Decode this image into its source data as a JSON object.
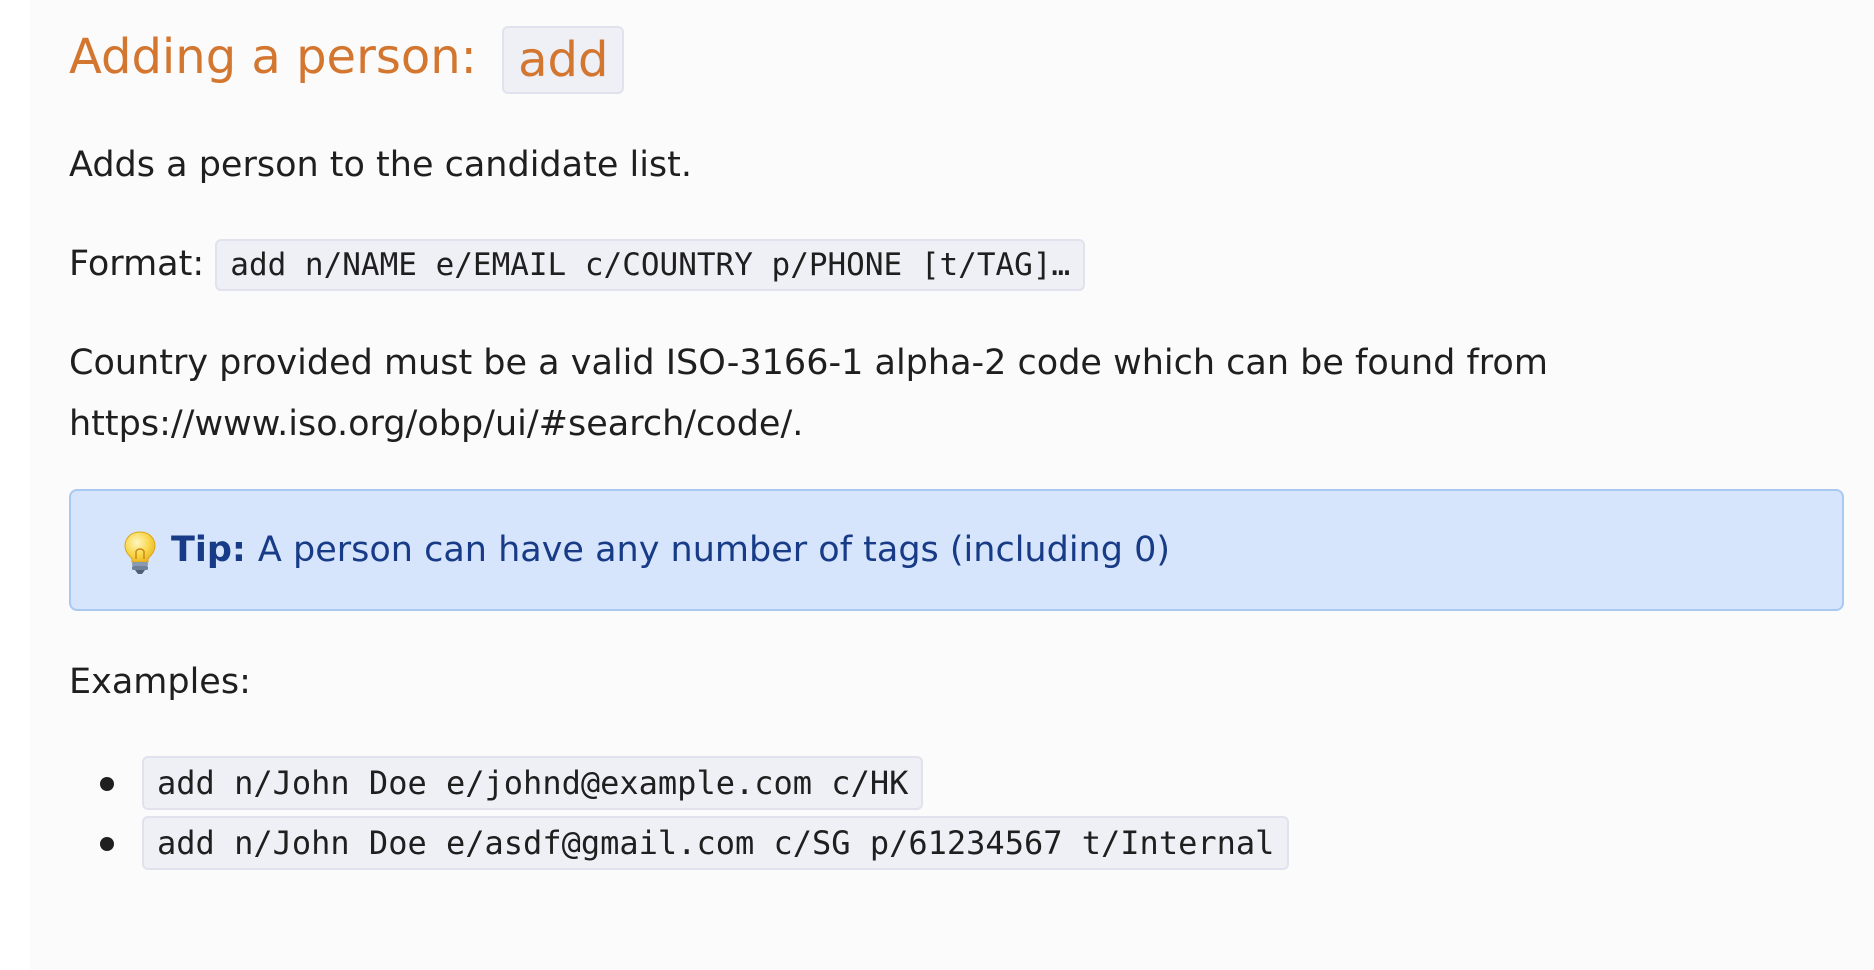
{
  "heading": {
    "text": "Adding a person:",
    "command": "add"
  },
  "description": "Adds a person to the candidate list.",
  "format": {
    "label": "Format:",
    "syntax": "add n/NAME e/EMAIL c/COUNTRY p/PHONE [t/TAG]…"
  },
  "country_note": {
    "line1": "Country provided must be a valid ISO-3166-1 alpha-2 code which can be found from",
    "line2": "https://www.iso.org/obp/ui/#search/code/."
  },
  "tip": {
    "icon": "lightbulb-icon",
    "label": "Tip:",
    "text": "A person can have any number of tags (including 0)"
  },
  "examples": {
    "label": "Examples:",
    "items": [
      "add n/John Doe e/johnd@example.com c/HK",
      "add n/John Doe e/asdf@gmail.com c/SG p/61234567 t/Internal"
    ]
  },
  "colors": {
    "heading": "#d37630",
    "tip_background": "#d6e5fb",
    "tip_border": "#a9c9f3",
    "tip_text": "#173b86",
    "code_background": "#efeff6"
  }
}
